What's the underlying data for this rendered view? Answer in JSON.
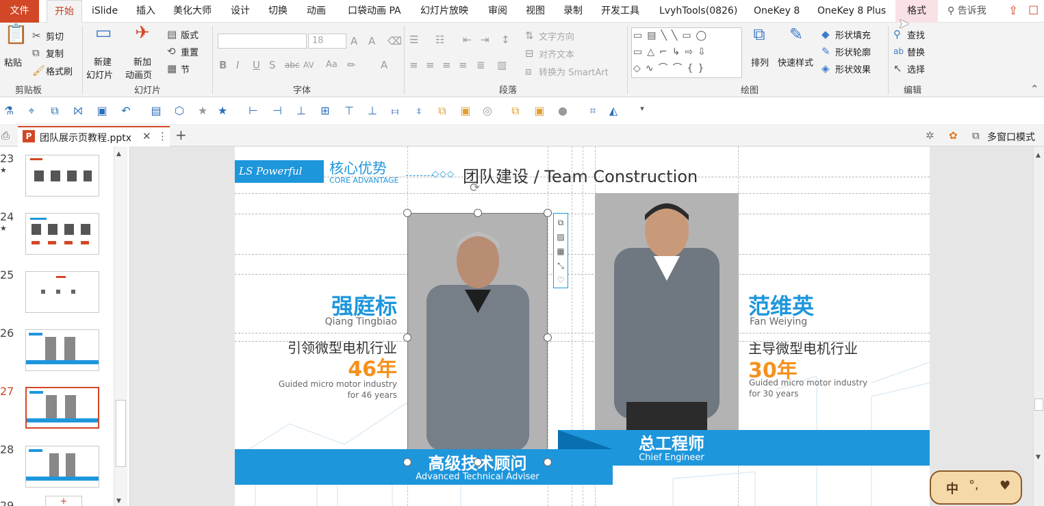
{
  "tabs": {
    "file": "文件",
    "home": "开始",
    "islide": "iSlide",
    "insert": "插入",
    "meihua": "美化大师",
    "design": "设计",
    "transitions": "切换",
    "animations": "动画",
    "pocket": "口袋动画 PA",
    "slideshow": "幻灯片放映",
    "review": "审阅",
    "view": "视图",
    "record": "录制",
    "developer": "开发工具",
    "lvyh": "LvyhTools(0826)",
    "onekey8": "OneKey 8",
    "onekey8plus": "OneKey 8 Plus",
    "format": "格式",
    "tellme": "告诉我"
  },
  "ribbon": {
    "clipboard": {
      "paste": "粘贴",
      "cut": "剪切",
      "copy": "复制",
      "format_painter": "格式刷",
      "group": "剪贴板"
    },
    "slides": {
      "new_slide_1": "新建",
      "new_slide_2": "幻灯片",
      "add_anim_1": "新加",
      "add_anim_2": "动画页",
      "layout": "版式",
      "reset": "重置",
      "section": "节",
      "group": "幻灯片"
    },
    "font": {
      "size": "18",
      "group": "字体"
    },
    "paragraph": {
      "text_direction": "文字方向",
      "align_text": "对齐文本",
      "convert_smartart": "转换为 SmartArt",
      "group": "段落"
    },
    "drawing": {
      "arrange": "排列",
      "quick_styles": "快速样式",
      "shape_fill": "形状填充",
      "shape_outline": "形状轮廓",
      "shape_effects": "形状效果",
      "group": "绘图"
    },
    "editing": {
      "find": "查找",
      "replace": "替换",
      "select": "选择",
      "group": "编辑"
    }
  },
  "doc": {
    "tab_title": "团队展示页教程.pptx",
    "multi_window": "多窗口模式"
  },
  "thumbnails": [
    {
      "num": "23",
      "star": "★"
    },
    {
      "num": "24",
      "star": "★"
    },
    {
      "num": "25",
      "star": ""
    },
    {
      "num": "26",
      "star": ""
    },
    {
      "num": "27",
      "star": ""
    },
    {
      "num": "28",
      "star": ""
    },
    {
      "num": "29",
      "star": ""
    }
  ],
  "slide": {
    "logo": "LS Powerful",
    "header_cn": "核心优势",
    "header_en": "CORE ADVANTAGE",
    "diamonds": "◇◇◇",
    "title": "团队建设 / Team Construction",
    "person1": {
      "name_cn": "强庭标",
      "name_en": "Qiang Tingbiao",
      "desc_cn": "引领微型电机行业",
      "years": "46年",
      "desc_en1": "Guided micro motor industry",
      "desc_en2": "for 46 years",
      "role_cn": "高级技术顾问",
      "role_en": "Advanced Technical Adviser"
    },
    "person2": {
      "name_cn": "范维英",
      "name_en": "Fan Weiying",
      "desc_cn": "主导微型电机行业",
      "years": "30年",
      "desc_en1": "Guided micro motor industry",
      "desc_en2": "for 30 years",
      "role_cn": "总工程师",
      "role_en": "Chief Engineer"
    }
  },
  "ime": {
    "label": "中",
    "punct": "°,"
  },
  "colors": {
    "accent": "#d24726",
    "brand_blue": "#1e96dc",
    "orange": "#f5911e"
  }
}
